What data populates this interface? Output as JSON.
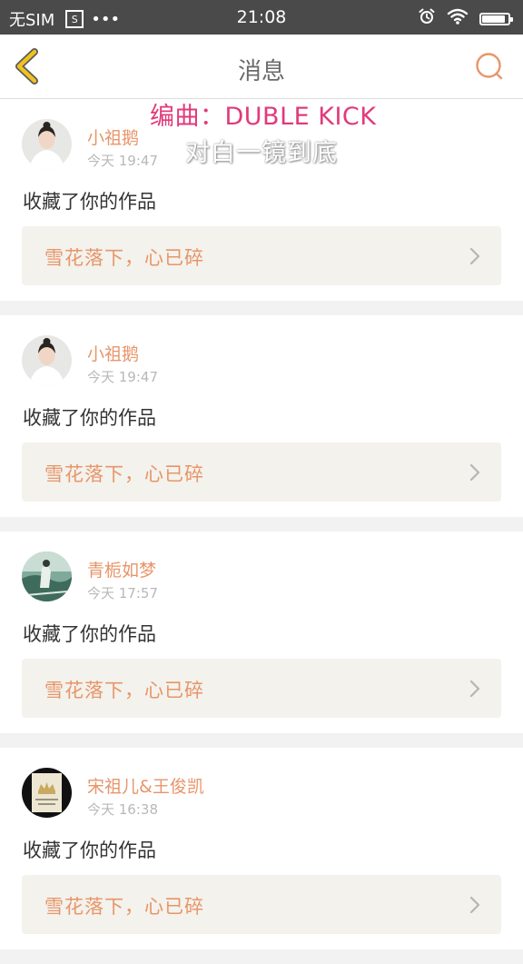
{
  "status_bar": {
    "carrier": "无SIM",
    "sim_icon_text": "S",
    "dots": "•••",
    "time": "21:08",
    "icons": [
      "sim-card-icon",
      "alarm-icon",
      "wifi-icon",
      "battery-icon"
    ],
    "battery_level": 0.95
  },
  "nav": {
    "title": "消息",
    "back_icon": "chevron-left-icon",
    "search_icon": "search-icon"
  },
  "overlay": {
    "title": "编曲：DUBLE KICK",
    "subtitle": "对白一镜到底"
  },
  "messages": [
    {
      "user": "小祖鹅",
      "time": "今天 19:47",
      "action": "收藏了你的作品",
      "work": "雪花落下，心已碎",
      "avatar": "avatar-woman-white"
    },
    {
      "user": "小祖鹅",
      "time": "今天 19:47",
      "action": "收藏了你的作品",
      "work": "雪花落下，心已碎",
      "avatar": "avatar-woman-white"
    },
    {
      "user": "青栀如梦",
      "time": "今天 17:57",
      "action": "收藏了你的作品",
      "work": "雪花落下，心已碎",
      "avatar": "avatar-green-scene"
    },
    {
      "user": "宋祖儿&王俊凯",
      "time": "今天 16:38",
      "action": "收藏了你的作品",
      "work": "雪花落下，心已碎",
      "avatar": "avatar-crown-card"
    }
  ],
  "colors": {
    "accent": "#e8956a",
    "overlay_pink": "#e13a7a",
    "status_bar_bg": "#4a4a4a",
    "work_box_bg": "#f3f2ec",
    "back_icon": "#f0c21f"
  }
}
